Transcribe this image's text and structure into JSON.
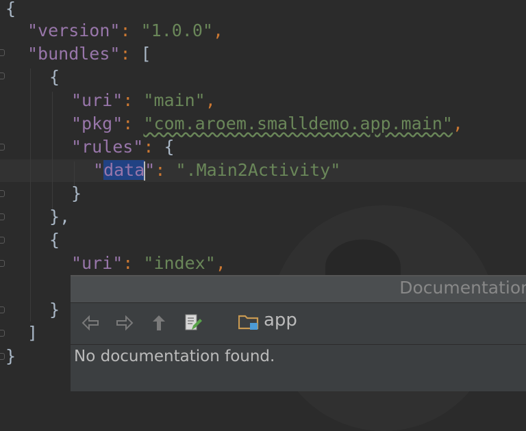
{
  "code": {
    "open_brace": "{",
    "version_key": "\"version\"",
    "version_value": "\"1.0.0\"",
    "bundles_key": "\"bundles\"",
    "bundles_open": "[",
    "obj_open": "{",
    "uri_key": "\"uri\"",
    "uri_main": "\"main\"",
    "pkg_key": "\"pkg\"",
    "pkg_value": "\"com.aroem.smalldemo.app.main\"",
    "rules_key": "\"rules\"",
    "data_key_pre": "\"",
    "data_key_sel": "data",
    "data_key_post": "\"",
    "data_value": "\".Main2Activity\"",
    "rules_close": "}",
    "obj_close": "},",
    "obj_open2": "{",
    "uri_index": "\"index\"",
    "obj_close2": "}",
    "bundles_close": "]",
    "close_brace": "}",
    "colon": ":",
    "comma": ","
  },
  "doc_popup": {
    "title": "Documentation",
    "path_label": "app",
    "body": "No documentation found.",
    "icons": [
      "back-arrow-icon",
      "forward-arrow-icon",
      "up-arrow-icon",
      "edit-source-icon",
      "folder-icon"
    ]
  },
  "colors": {
    "background": "#2b2b2b",
    "key": "#9876aa",
    "string": "#6a8759",
    "punctuation": "#cc7832",
    "selection": "#214283",
    "popup_bg": "#3c3f41"
  }
}
